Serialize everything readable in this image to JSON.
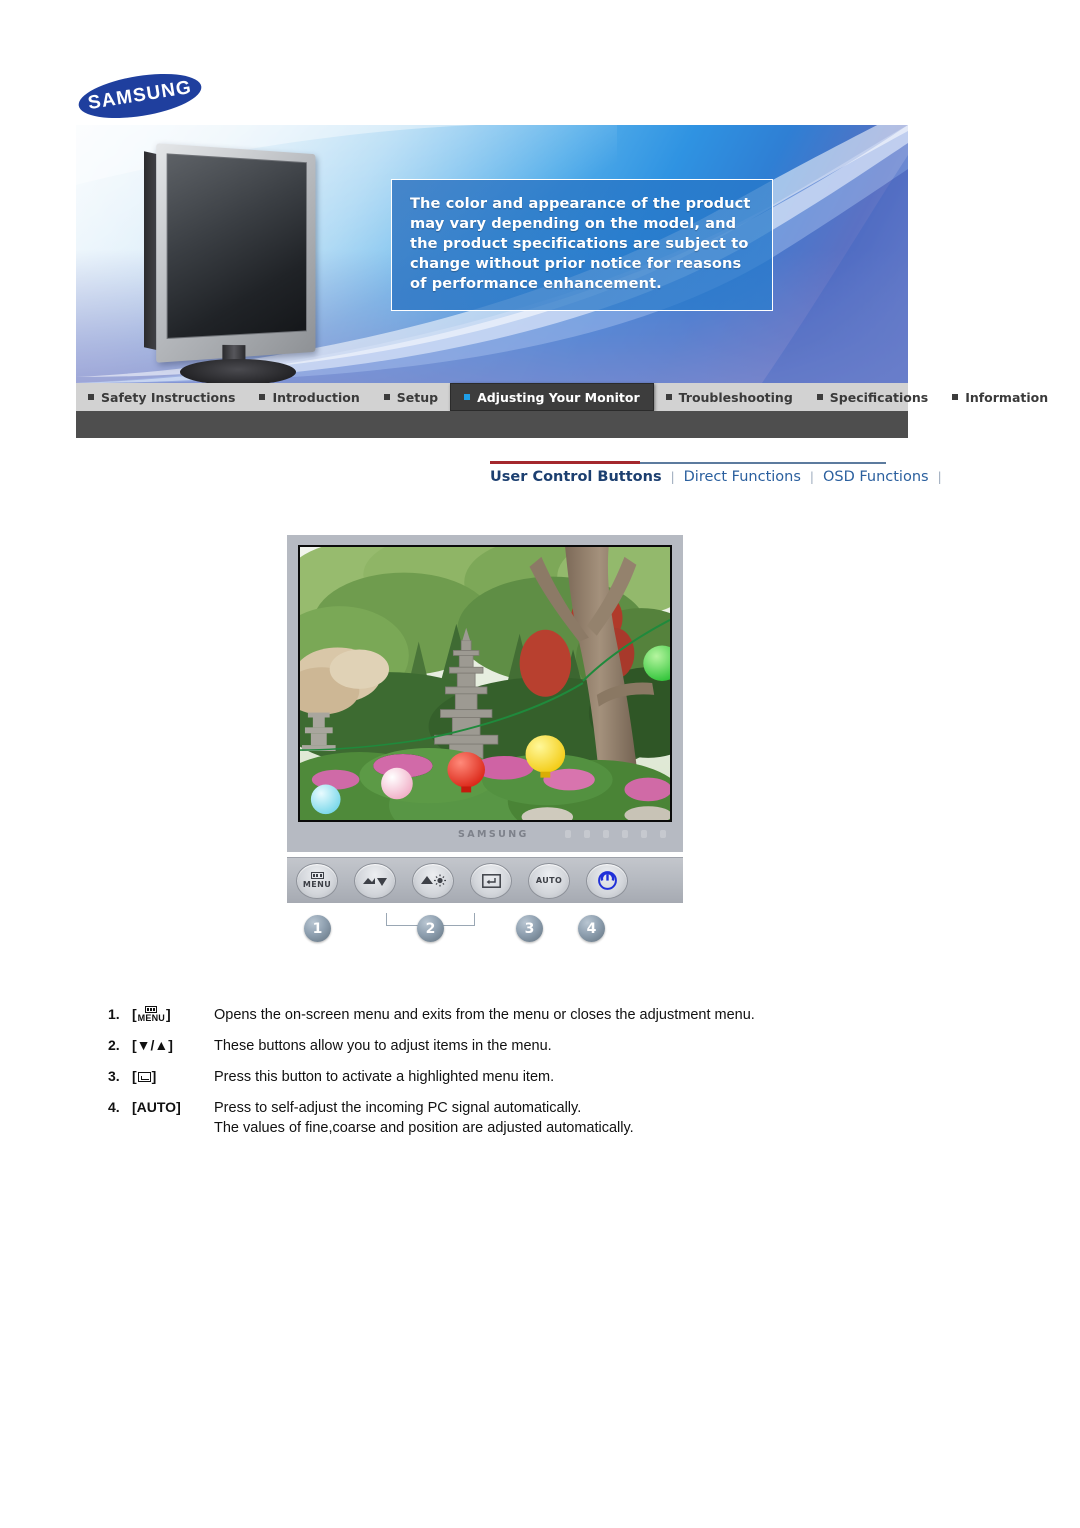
{
  "brand": {
    "logo_text": "SAMSUNG",
    "logo_color": "#1f3f9e"
  },
  "banner": {
    "notice": "The color and appearance of the product may vary depending on the model, and the product specifications are subject to change without prior notice for reasons of performance enhancement.",
    "product_image_alt": "samsung-lcd-monitor"
  },
  "main_nav": {
    "tabs": [
      {
        "label": "Safety Instructions",
        "active": false
      },
      {
        "label": "Introduction",
        "active": false
      },
      {
        "label": "Setup",
        "active": false
      },
      {
        "label": "Adjusting Your Monitor",
        "active": true
      },
      {
        "label": "Troubleshooting",
        "active": false
      },
      {
        "label": "Specifications",
        "active": false
      },
      {
        "label": "Information",
        "active": false
      }
    ],
    "active_bullet_color": "#1f9fe8",
    "bullet_color": "#3c3c3c",
    "bar_color": "#d2d2d2",
    "underbar_color": "#4e4e4e"
  },
  "sub_nav": {
    "items": [
      {
        "label": "User Control Buttons",
        "current": true
      },
      {
        "label": "Direct Functions",
        "current": false
      },
      {
        "label": "OSD Functions",
        "current": false
      }
    ],
    "separator": "|",
    "rule_red": "#a4282d",
    "rule_blue": "#5c7b9e"
  },
  "figure": {
    "panel_brand": "SAMSUNG",
    "screen_image_alt": "korean-temple-garden-with-stone-pagoda-and-lanterns",
    "buttons": [
      {
        "name": "menu-button",
        "label": "MENU",
        "icon": "menu-icon"
      },
      {
        "name": "down-button",
        "label": "",
        "icon": "down-arrow-icon"
      },
      {
        "name": "up-brightness-button",
        "label": "",
        "icon": "up-arrow-brightness-icon"
      },
      {
        "name": "enter-button",
        "label": "",
        "icon": "enter-icon"
      },
      {
        "name": "auto-button",
        "label": "AUTO",
        "icon": "auto-label-icon"
      },
      {
        "name": "power-button",
        "label": "",
        "icon": "power-icon"
      }
    ],
    "callouts": [
      "1",
      "2",
      "3",
      "4"
    ],
    "power_icon_color": "#2030d8"
  },
  "descriptions": [
    {
      "number": "1.",
      "key_type": "menu",
      "key_label": "MENU",
      "text": "Opens the on-screen menu and exits from the menu or closes the adjustment menu.",
      "text_line2": ""
    },
    {
      "number": "2.",
      "key_type": "text",
      "key_label": "[▼/▲]",
      "text": "These buttons allow you to adjust items in the menu.",
      "text_line2": ""
    },
    {
      "number": "3.",
      "key_type": "enter",
      "key_label": "",
      "text": "Press this button to activate a highlighted menu item.",
      "text_line2": ""
    },
    {
      "number": "4.",
      "key_type": "text",
      "key_label": "[AUTO]",
      "text": "Press to self-adjust the incoming PC signal automatically.",
      "text_line2": "The values of fine,coarse and position are adjusted automatically."
    }
  ]
}
